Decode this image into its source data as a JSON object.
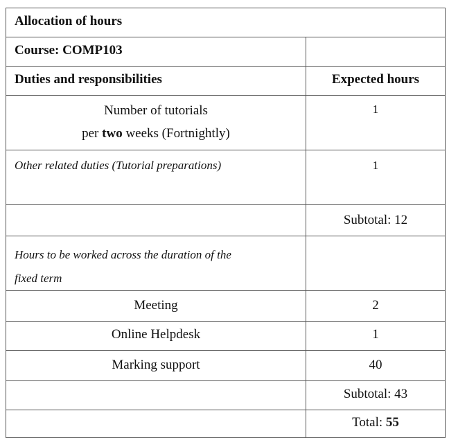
{
  "title": "Allocation of hours",
  "course": "Course: COMP103",
  "header": {
    "col1": "Duties and responsibilities",
    "col2": "Expected hours"
  },
  "rows": {
    "tutorials": {
      "line1": "Number of tutorials",
      "line2_prefix": "per ",
      "line2_bold": "two",
      "line2_suffix": " weeks (Fortnightly)",
      "hours": "1"
    },
    "other_duties": {
      "label": "Other related duties (Tutorial preparations)",
      "hours": "1"
    },
    "subtotal1": "Subtotal: 12",
    "fixed_term": {
      "line1": "Hours to be worked across the duration of the",
      "line2": "fixed term"
    },
    "meeting": {
      "label": "Meeting",
      "hours": "2"
    },
    "helpdesk": {
      "label": "Online Helpdesk",
      "hours": "1"
    },
    "marking": {
      "label": "Marking support",
      "hours": "40"
    },
    "subtotal2": "Subtotal: 43",
    "total_prefix": "Total: ",
    "total_value": "55"
  }
}
